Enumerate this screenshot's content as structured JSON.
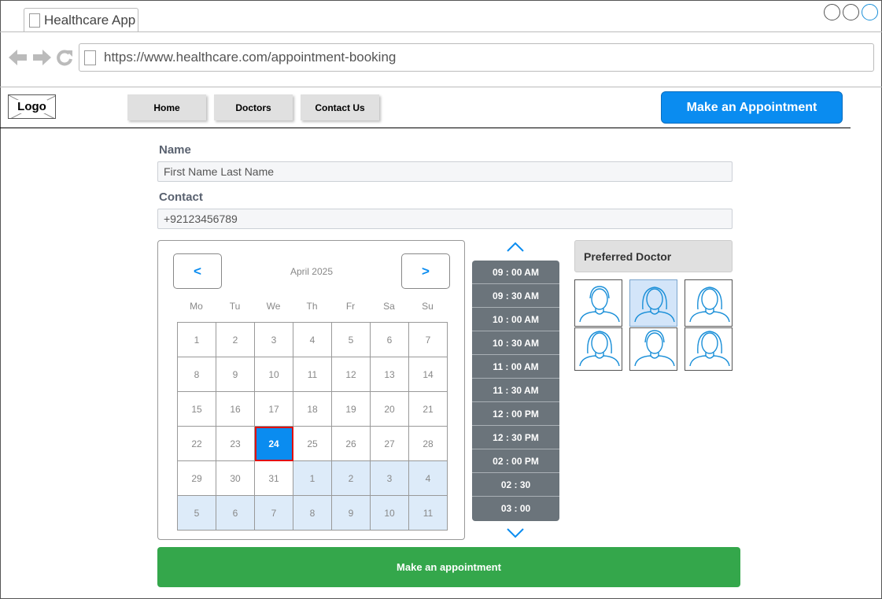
{
  "browser": {
    "tab_title": "Healthcare App",
    "url": "https://www.healthcare.com/appointment-booking"
  },
  "header": {
    "logo_text": "Logo",
    "nav": [
      "Home",
      "Doctors",
      "Contact Us"
    ],
    "cta_label": "Make an Appointment"
  },
  "form": {
    "name_label": "Name",
    "name_value": "First Name Last Name",
    "contact_label": "Contact",
    "contact_value": "+92123456789"
  },
  "calendar": {
    "prev_label": "<",
    "next_label": ">",
    "month": "April 2025",
    "weekdays": [
      "Mo",
      "Tu",
      "We",
      "Th",
      "Fr",
      "Sa",
      "Su"
    ],
    "days": [
      "1",
      "2",
      "3",
      "4",
      "5",
      "6",
      "7",
      "8",
      "9",
      "10",
      "11",
      "12",
      "13",
      "14",
      "15",
      "16",
      "17",
      "18",
      "19",
      "20",
      "21",
      "22",
      "23",
      "24",
      "25",
      "26",
      "27",
      "28",
      "29",
      "30",
      "31",
      "1",
      "2",
      "3",
      "4",
      "5",
      "6",
      "7",
      "8",
      "9",
      "10",
      "11"
    ],
    "next_month_start_index": 31,
    "selected_index": 23
  },
  "time_slots": [
    "09 : 00 AM",
    "09 : 30 AM",
    "10 : 00 AM",
    "10 : 30 AM",
    "11 : 00 AM",
    "11 : 30 AM",
    "12 : 00 PM",
    "12 : 30 PM",
    "02 : 00 PM",
    "02 : 30",
    "03 : 00"
  ],
  "doctors": {
    "title": "Preferred Doctor",
    "avatars": [
      "male-doctor-icon",
      "female-doctor-icon",
      "female-doctor-icon",
      "female-doctor-icon",
      "male-doctor-icon",
      "female-doctor-icon"
    ],
    "selected_index": 1
  },
  "submit_label": "Make an appointment",
  "colors": {
    "accent": "#0a8cf0",
    "success": "#34a74b",
    "selected_border": "#e01010",
    "time_panel": "#6b747b"
  }
}
